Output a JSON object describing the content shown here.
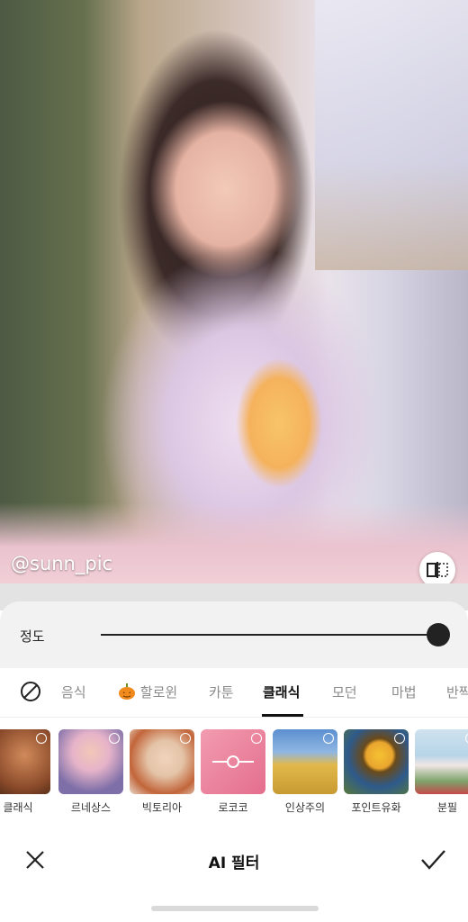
{
  "photo": {
    "watermark": "@sunn_pic"
  },
  "compare_button": {
    "icon": "compare-split-icon"
  },
  "strength": {
    "label": "정도",
    "value": 1.0
  },
  "tabs": [
    {
      "label": "",
      "icon": "none-circle-slash-icon"
    },
    {
      "label": "음식"
    },
    {
      "label": "할로윈",
      "icon": "pumpkin-icon"
    },
    {
      "label": "카툰"
    },
    {
      "label": "클래식",
      "active": true
    },
    {
      "label": "모던"
    },
    {
      "label": "마법"
    },
    {
      "label": "반짝"
    }
  ],
  "filters": [
    {
      "name": "클래식",
      "color_a": "#8a4a2a",
      "color_b": "#d18a5a"
    },
    {
      "name": "르네상스",
      "color_a": "#7e6fa8",
      "color_b": "#e6b3c9"
    },
    {
      "name": "빅토리아",
      "color_a": "#e4c4a8",
      "color_b": "#c2653a"
    },
    {
      "name": "로코코",
      "color_a": "#e46e8d",
      "color_b": "#f29cb0",
      "selected_icon": "slider-dot-icon"
    },
    {
      "name": "인상주의",
      "color_a": "#3d78b8",
      "color_b": "#e2b84a"
    },
    {
      "name": "포인트유화",
      "color_a": "#2e5a8c",
      "color_b": "#e9a52e"
    },
    {
      "name": "분필",
      "color_a": "#b7d4e8",
      "color_b": "#7ea36a"
    }
  ],
  "bottom_bar": {
    "title": "AI 필터",
    "close_icon": "close-icon",
    "apply_icon": "check-icon"
  },
  "colors": {
    "accent": "#111111",
    "panel": "#f2f2f2"
  }
}
